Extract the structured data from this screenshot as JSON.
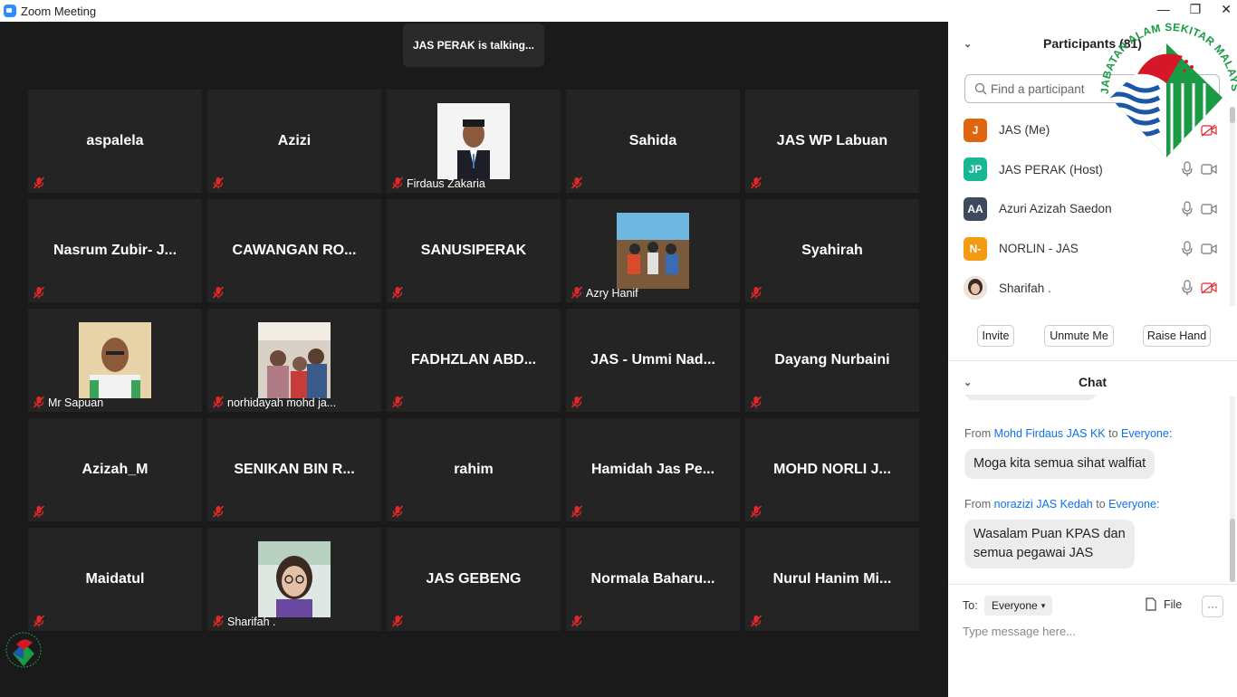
{
  "window": {
    "title": "Zoom Meeting"
  },
  "talking_indicator": "JAS PERAK is talking...",
  "tiles": [
    {
      "name": "aspalela"
    },
    {
      "name": "Azizi"
    },
    {
      "label": "Firdaus Zakaria",
      "photo": "man-formal-portrait"
    },
    {
      "name": "Sahida"
    },
    {
      "name": "JAS WP Labuan"
    },
    {
      "name": "Nasrum  Zubir- J..."
    },
    {
      "name": "CAWANGAN  RO..."
    },
    {
      "name": "SANUSIPERAK"
    },
    {
      "label": "Azry Hanif",
      "photo": "group-outdoor-photo"
    },
    {
      "name": "Syahirah"
    },
    {
      "label": "Mr Sapuan",
      "photo": "man-portrait"
    },
    {
      "label": "norhidayah mohd ja...",
      "photo": "family-car-photo"
    },
    {
      "name": "FADHZLAN  ABD..."
    },
    {
      "name": "JAS - Ummi Nad..."
    },
    {
      "name": "Dayang Nurbaini"
    },
    {
      "name": "Azizah_M"
    },
    {
      "name": "SENIKAN BIN R..."
    },
    {
      "name": "rahim"
    },
    {
      "name": "Hamidah Jas Pe..."
    },
    {
      "name": "MOHD  NORLI  J..."
    },
    {
      "name": "Maidatul"
    },
    {
      "label": "Sharifah .",
      "photo": "woman-glasses-portrait"
    },
    {
      "name": "JAS GEBENG"
    },
    {
      "name": "Normala  Baharu..."
    },
    {
      "name": "Nurul  Hanim  Mi..."
    }
  ],
  "participants": {
    "header": "Participants (81)",
    "search_placeholder": "Find a participant",
    "list": [
      {
        "initials": "J",
        "name": "JAS (Me)",
        "color": "#e0650f",
        "mic": "none",
        "cam": "off"
      },
      {
        "initials": "JP",
        "name": "JAS PERAK (Host)",
        "color": "#17b893",
        "mic": "on",
        "cam": "on"
      },
      {
        "initials": "AA",
        "name": "Azuri Azizah Saedon",
        "color": "#3d4a5c",
        "mic": "on",
        "cam": "on"
      },
      {
        "initials": "N-",
        "name": "NORLIN - JAS",
        "color": "#f39c12",
        "mic": "on",
        "cam": "on"
      },
      {
        "initials": "",
        "name": "Sharifah .",
        "color": "#c9a08a",
        "mic": "on",
        "cam": "off"
      }
    ],
    "buttons": {
      "invite": "Invite",
      "unmute": "Unmute Me",
      "raise_hand": "Raise Hand"
    }
  },
  "chat": {
    "header": "Chat",
    "messages": [
      {
        "from_prefix": "From",
        "from": "Mohd Firdaus JAS KK",
        "to_word": "to",
        "to": "Everyone:",
        "text": "Moga kita semua sihat walfiat"
      },
      {
        "from_prefix": "From",
        "from": "norazizi JAS Kedah",
        "to_word": "to",
        "to": "Everyone:",
        "text_line1": "Wasalam Puan KPAS dan",
        "text_line2": "semua pegawai JAS"
      }
    ],
    "to_label": "To:",
    "to_value": "Everyone",
    "file_label": "File",
    "input_placeholder": "Type message here..."
  },
  "logo": {
    "text": "JABATAN ALAM SEKITAR MALAYSIA",
    "colors": {
      "red": "#d6172a",
      "green": "#1a9a44",
      "blue": "#1b57a6"
    }
  }
}
